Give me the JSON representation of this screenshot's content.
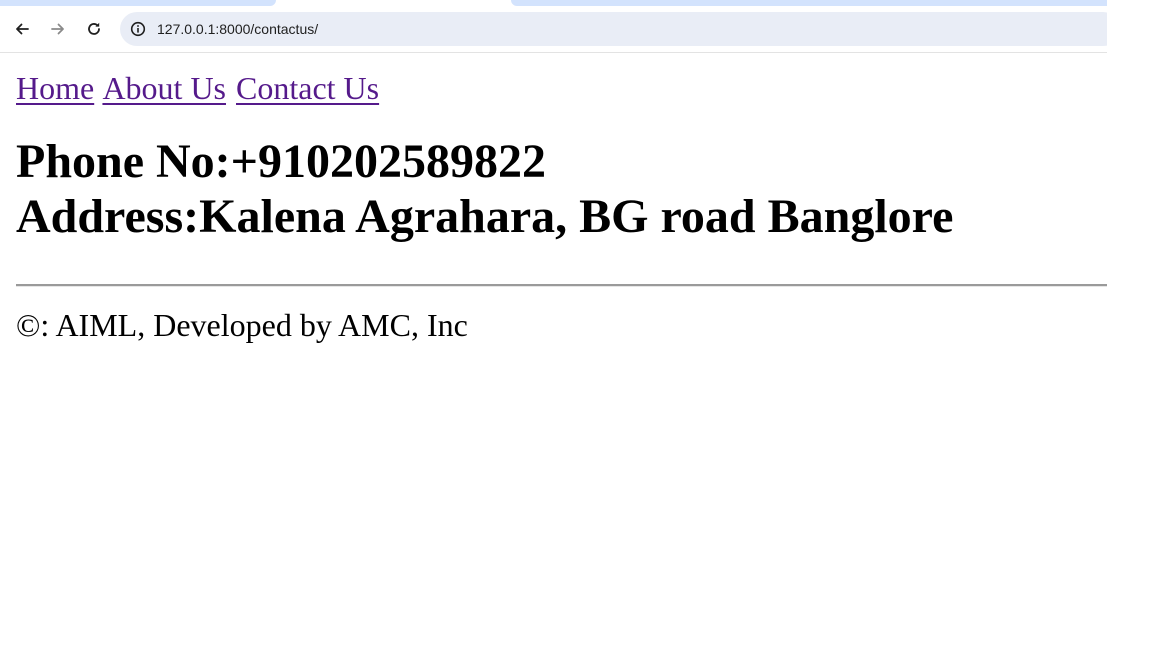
{
  "browser": {
    "back_icon": "arrow-left-icon",
    "forward_icon": "arrow-right-icon",
    "reload_icon": "reload-icon",
    "site_info_icon": "info-icon",
    "url": "127.0.0.1:8000/contactus/",
    "accent_color": "#d3e3fd",
    "omnibox_color": "#e9edf6"
  },
  "nav": {
    "links": [
      {
        "label": "Home"
      },
      {
        "label": "About Us"
      },
      {
        "label": "Contact Us"
      }
    ],
    "link_color": "#551a8b"
  },
  "contact": {
    "phone": "Phone No:+910202589822",
    "address": "Address:Kalena Agrahara, BG road Banglore"
  },
  "footer": {
    "text": "©: AIML, Developed by AMC, Inc"
  }
}
